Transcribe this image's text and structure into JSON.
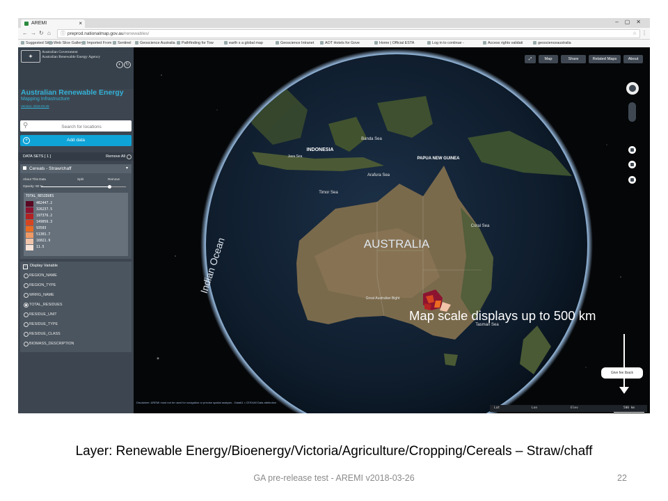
{
  "browser": {
    "tab_title": "AREMI",
    "tab_close": "×",
    "url_host": "preprod.nationalmap.gov.au",
    "url_path": "/renewables/",
    "bookmarks": [
      "Suggested Sites",
      "Web Slice Gallery",
      "Imported From IE",
      "Sentinel",
      "Geoscience Australia",
      "Pathfinding for Tow",
      "earth s a global map",
      "Geoscience Intranet",
      "AOT Hotels for Gove",
      "Home | Official ESTA",
      "Log in to continue -",
      "Access rights validati",
      "geoscienceaustralia"
    ]
  },
  "sidebar": {
    "gov_line1": "Australian Government",
    "gov_line2": "Australian Renewable Energy Agency",
    "app_title": "Australian Renewable Energy",
    "app_subtitle": "Mapping Infrastructure",
    "version": "Version: 2018-03-26",
    "search_placeholder": "Search for locations",
    "add_data_label": "Add data",
    "datasets_label": "DATA SETS  [ 1 ]",
    "remove_all_label": "Remove All",
    "layer": {
      "name": "Cereals - Straw/chaff",
      "about_label": "About This Data",
      "split_label": "Split",
      "remove_label": "Remove",
      "opacity_label": "Opacity: 80 %",
      "opacity_value": 0.8,
      "legend_title": "TOTAL_RESIDUES",
      "legend": [
        {
          "label": "482447.2",
          "color": "#5a0722"
        },
        {
          "label": "326237.5",
          "color": "#8c1430"
        },
        {
          "label": "197376.2",
          "color": "#b32223"
        },
        {
          "label": "149056.3",
          "color": "#d64520"
        },
        {
          "label": "93503",
          "color": "#ec6b22"
        },
        {
          "label": "51301.7",
          "color": "#ee9a67"
        },
        {
          "label": "16021.9",
          "color": "#f1c3a8"
        },
        {
          "label": "11.5",
          "color": "#f7e2d7"
        }
      ]
    },
    "display_variable": {
      "heading": "Display Variable",
      "options": [
        "REGION_NAME",
        "REGION_TYPE",
        "WRRG_NAME",
        "TOTAL_RESIDUES",
        "RESIDUE_UNIT",
        "RESIDUE_TYPE",
        "RESIDUE_CLASS",
        "BIOMASS_DESCRIPTION"
      ],
      "selected": "TOTAL_RESIDUES"
    },
    "disclaimer": "Disclaimer: AREMI must not be used for navigation or precise spatial analysis - Data61 • CESIUM  Data attribution"
  },
  "map": {
    "top_buttons": [
      "Map",
      "Share",
      "Related Maps",
      "About"
    ],
    "labels": {
      "indonesia": "INDONESIA",
      "papua": "PAPUA NEW GUINEA",
      "australia": "AUSTRALIA",
      "indian_ocean": "Indian Ocean",
      "coral_sea": "Coral Sea",
      "timor_sea": "Timor Sea",
      "arafura_sea": "Arafura Sea",
      "banda_sea": "Banda Sea",
      "java_sea": "Java Sea",
      "tasman_sea": "Tasman Sea",
      "gab": "Great Australian Bight"
    },
    "feedback_label": "Give feedback",
    "status": {
      "lat": "Lat",
      "lon": "Lon",
      "elev": "Elev",
      "scale": "500 km"
    }
  },
  "annotation": "Map scale displays up to 500 km",
  "slide": {
    "caption": "Layer: Renewable Energy/Bioenergy/Victoria/Agriculture/Cropping/Cereals – Straw/chaff",
    "footer": "GA pre-release test - AREMI v2018-03-26",
    "page_number": "22"
  }
}
